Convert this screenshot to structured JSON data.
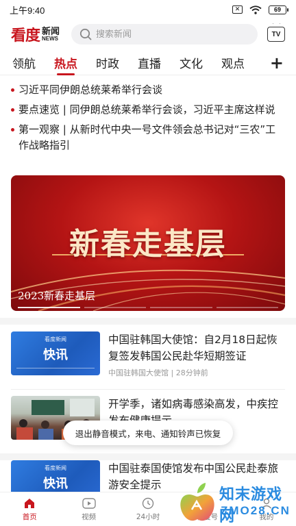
{
  "status_bar": {
    "time": "上午9:40",
    "battery": "69"
  },
  "header": {
    "logo_main": "看度",
    "logo_sub_cn": "新闻",
    "logo_sub_en": "NEWS",
    "search_placeholder": "搜索新闻",
    "tv_label": "TV"
  },
  "tabs": [
    {
      "label": "领航"
    },
    {
      "label": "热点"
    },
    {
      "label": "时政"
    },
    {
      "label": "直播"
    },
    {
      "label": "文化"
    },
    {
      "label": "观点"
    }
  ],
  "active_tab_index": 1,
  "headlines": [
    "习近平同伊朗总统莱希举行会谈",
    "要点速览 | 同伊朗总统莱希举行会谈，习近平主席这样说",
    "第一观察 | 从新时代中央一号文件领会总书记对“三农”工作战略指引"
  ],
  "banner": {
    "title": "新春走基层",
    "caption": "2023新春走基层"
  },
  "news": [
    {
      "thumb_logo": "看度新闻",
      "thumb_text": "快讯",
      "title": "中国驻韩国大使馆：自2月18日起恢复签发韩国公民赴华短期签证",
      "source": "中国驻韩国大使馆",
      "time": "28分钟前"
    },
    {
      "title": "开学季，诸如病毒感染高发，中疾控发布健康提示"
    },
    {
      "thumb_logo": "看度新闻",
      "thumb_text": "快讯",
      "title": "中国驻泰国使馆发布中国公民赴泰旅游安全提示"
    }
  ],
  "toast": "退出静音模式，来电、通知铃声已恢复",
  "bottom_nav": [
    {
      "label": "首页",
      "icon": "home-icon"
    },
    {
      "label": "视频",
      "icon": "video-icon"
    },
    {
      "label": "24小时",
      "icon": "clock-24-icon"
    },
    {
      "label": "看度号",
      "icon": "account-icon"
    },
    {
      "label": "我的",
      "icon": "profile-icon"
    }
  ],
  "watermark": {
    "text_cn": "知末游戏网",
    "text_en": "ZMO28.CN"
  },
  "colors": {
    "accent": "#c8161e",
    "thumb_blue": "#2f7ce0"
  }
}
